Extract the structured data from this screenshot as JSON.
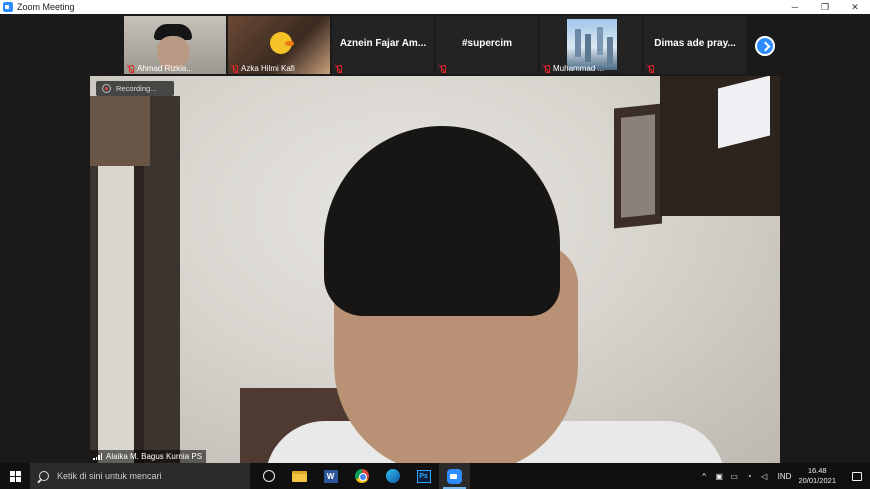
{
  "window": {
    "title": "Zoom Meeting",
    "minimize_glyph": "─",
    "restore_glyph": "❐",
    "close_glyph": "✕"
  },
  "participants": [
    {
      "name": "Ahmad Rizkia...",
      "video": true,
      "muted": true
    },
    {
      "name": "Azka Hilmi Kafi",
      "video": true,
      "muted": true
    },
    {
      "display_name": "Aznein Fajar Am...",
      "video": false,
      "muted": true
    },
    {
      "display_name": "#supercim",
      "video": false,
      "muted": true
    },
    {
      "name": "Muhammad ...",
      "video": true,
      "muted": true
    },
    {
      "display_name": "Dimas ade pray...",
      "video": false,
      "muted": true
    }
  ],
  "main_video": {
    "recording_label": "Recording...",
    "speaker_name": "Alaika M. Bagus Kurnia PS"
  },
  "taskbar": {
    "search_placeholder": "Ketik di sini untuk mencari",
    "word_letter": "W",
    "ps_letters": "Ps",
    "tray": {
      "chevron": "^",
      "language": "IND",
      "time": "16.48",
      "date": "20/01/2021"
    }
  },
  "colors": {
    "zoom_blue": "#2d8cff",
    "muted_red": "#e02828",
    "taskbar": "#101010"
  }
}
